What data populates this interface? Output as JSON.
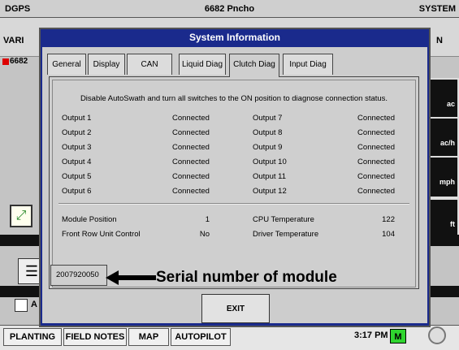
{
  "app": {
    "top_left": "DGPS",
    "title": "6682 Pncho",
    "top_right": "SYSTEM",
    "row2_left": "VARI",
    "row2_right": "N",
    "item_code": "6682"
  },
  "right_tiles": [
    "ac",
    "ac/h",
    "mph",
    "ft"
  ],
  "left_controls": {
    "check_label": "A"
  },
  "bottom_bar": {
    "tabs": [
      "PLANTING",
      "FIELD NOTES",
      "MAP",
      "AUTOPILOT"
    ],
    "time": "3:17 PM",
    "mode": "M"
  },
  "dialog": {
    "title": "System Information",
    "tabs": [
      "General",
      "Display",
      "CAN",
      "Liquid Diag",
      "Clutch Diag",
      "Input Diag"
    ],
    "active_tab": "Clutch Diag",
    "instruction": "Disable AutoSwath and turn all switches to the ON position to diagnose connection status.",
    "outputs_left": [
      {
        "name": "Output 1",
        "status": "Connected"
      },
      {
        "name": "Output 2",
        "status": "Connected"
      },
      {
        "name": "Output 3",
        "status": "Connected"
      },
      {
        "name": "Output 4",
        "status": "Connected"
      },
      {
        "name": "Output 5",
        "status": "Connected"
      },
      {
        "name": "Output 6",
        "status": "Connected"
      }
    ],
    "outputs_right": [
      {
        "name": "Output 7",
        "status": "Connected"
      },
      {
        "name": "Output 8",
        "status": "Connected"
      },
      {
        "name": "Output 9",
        "status": "Connected"
      },
      {
        "name": "Output 10",
        "status": "Connected"
      },
      {
        "name": "Output 11",
        "status": "Connected"
      },
      {
        "name": "Output 12",
        "status": "Connected"
      }
    ],
    "info": {
      "module_position_label": "Module Position",
      "module_position_value": "1",
      "front_row_label": "Front Row Unit Control",
      "front_row_value": "No",
      "cpu_temp_label": "CPU Temperature",
      "cpu_temp_value": "122",
      "driver_temp_label": "Driver Temperature",
      "driver_temp_value": "104"
    },
    "serial": "2007920050",
    "callout": "Serial number of module",
    "exit_label": "EXIT"
  },
  "colors": {
    "dialog_frame": "#1a2a8c",
    "mode_indicator": "#2fd52f"
  }
}
